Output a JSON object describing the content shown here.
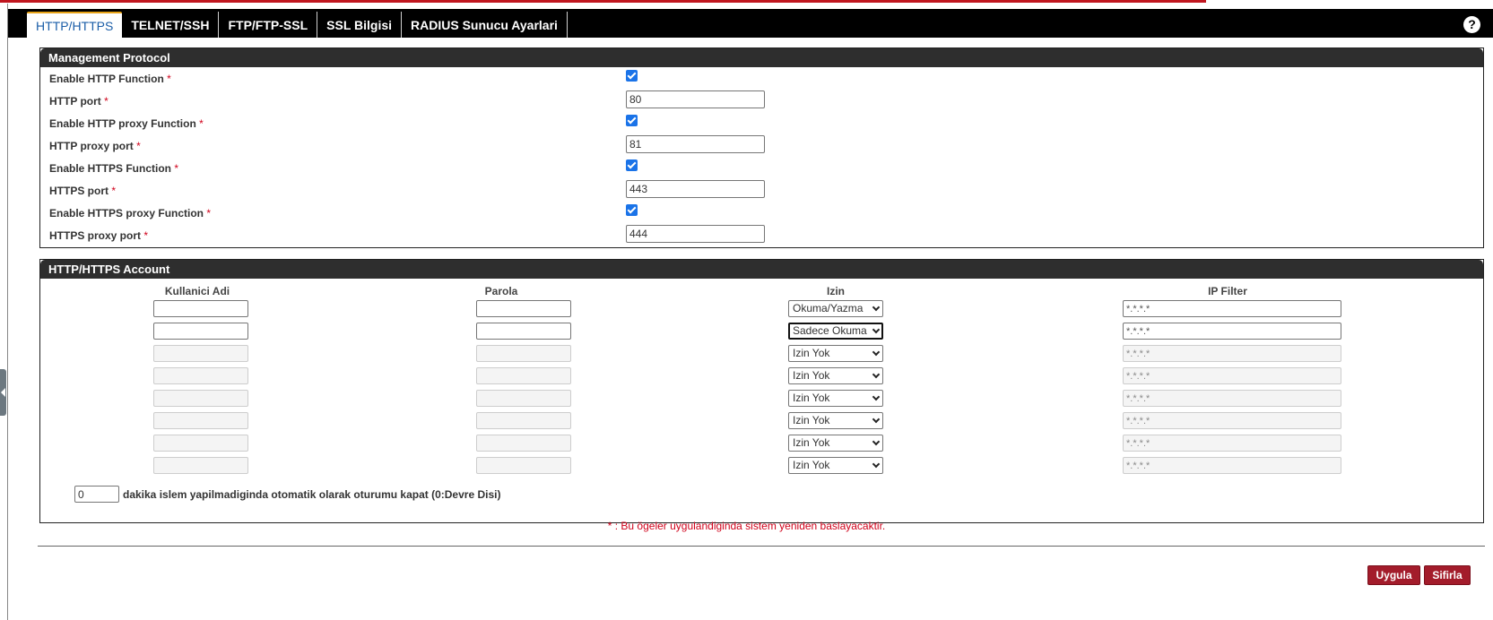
{
  "tabs": [
    {
      "label": "HTTP/HTTPS",
      "active": true
    },
    {
      "label": "TELNET/SSH"
    },
    {
      "label": "FTP/FTP-SSL"
    },
    {
      "label": "SSL Bilgisi"
    },
    {
      "label": "RADIUS Sunucu Ayarlari"
    }
  ],
  "help_label": "?",
  "management": {
    "title": "Management Protocol",
    "required_mark": "*",
    "fields": [
      {
        "label": "Enable HTTP Function",
        "type": "checkbox",
        "checked": true
      },
      {
        "label": "HTTP port",
        "type": "text",
        "value": "80"
      },
      {
        "label": "Enable HTTP proxy Function",
        "type": "checkbox",
        "checked": true
      },
      {
        "label": "HTTP proxy port",
        "type": "text",
        "value": "81"
      },
      {
        "label": "Enable HTTPS Function",
        "type": "checkbox",
        "checked": true
      },
      {
        "label": "HTTPS port",
        "type": "text",
        "value": "443"
      },
      {
        "label": "Enable HTTPS proxy Function",
        "type": "checkbox",
        "checked": true
      },
      {
        "label": "HTTPS proxy port",
        "type": "text",
        "value": "444"
      }
    ]
  },
  "account": {
    "title": "HTTP/HTTPS Account",
    "columns": [
      "Kullanici Adi",
      "Parola",
      "Izin",
      "IP Filter"
    ],
    "rows": [
      {
        "user": "",
        "pass": "",
        "perm": "Okuma/Yazma",
        "ip": "*.*.*.*",
        "enabled": true
      },
      {
        "user": "",
        "pass": "",
        "perm": "Sadece Okuma",
        "ip": "*.*.*.*",
        "enabled": true,
        "focused": true
      },
      {
        "user": "",
        "pass": "",
        "perm": "Izin Yok",
        "ip": "*.*.*.*",
        "enabled": false
      },
      {
        "user": "",
        "pass": "",
        "perm": "Izin Yok",
        "ip": "*.*.*.*",
        "enabled": false
      },
      {
        "user": "",
        "pass": "",
        "perm": "Izin Yok",
        "ip": "*.*.*.*",
        "enabled": false
      },
      {
        "user": "",
        "pass": "",
        "perm": "Izin Yok",
        "ip": "*.*.*.*",
        "enabled": false
      },
      {
        "user": "",
        "pass": "",
        "perm": "Izin Yok",
        "ip": "*.*.*.*",
        "enabled": false
      },
      {
        "user": "",
        "pass": "",
        "perm": "Izin Yok",
        "ip": "*.*.*.*",
        "enabled": false
      }
    ],
    "timeout_value": "0",
    "timeout_label": "dakika islem yapilmadiginda otomatik olarak oturumu kapat (0:Devre Disi)"
  },
  "note": "* : Bu ögeler uygulandiginda sistem yeniden baslayacaktir.",
  "buttons": {
    "apply": "Uygula",
    "reset": "Sifirla"
  },
  "colors": {
    "accent": "#a31c2b",
    "required": "#d0021b",
    "tab_active": "#1b5ea8"
  }
}
